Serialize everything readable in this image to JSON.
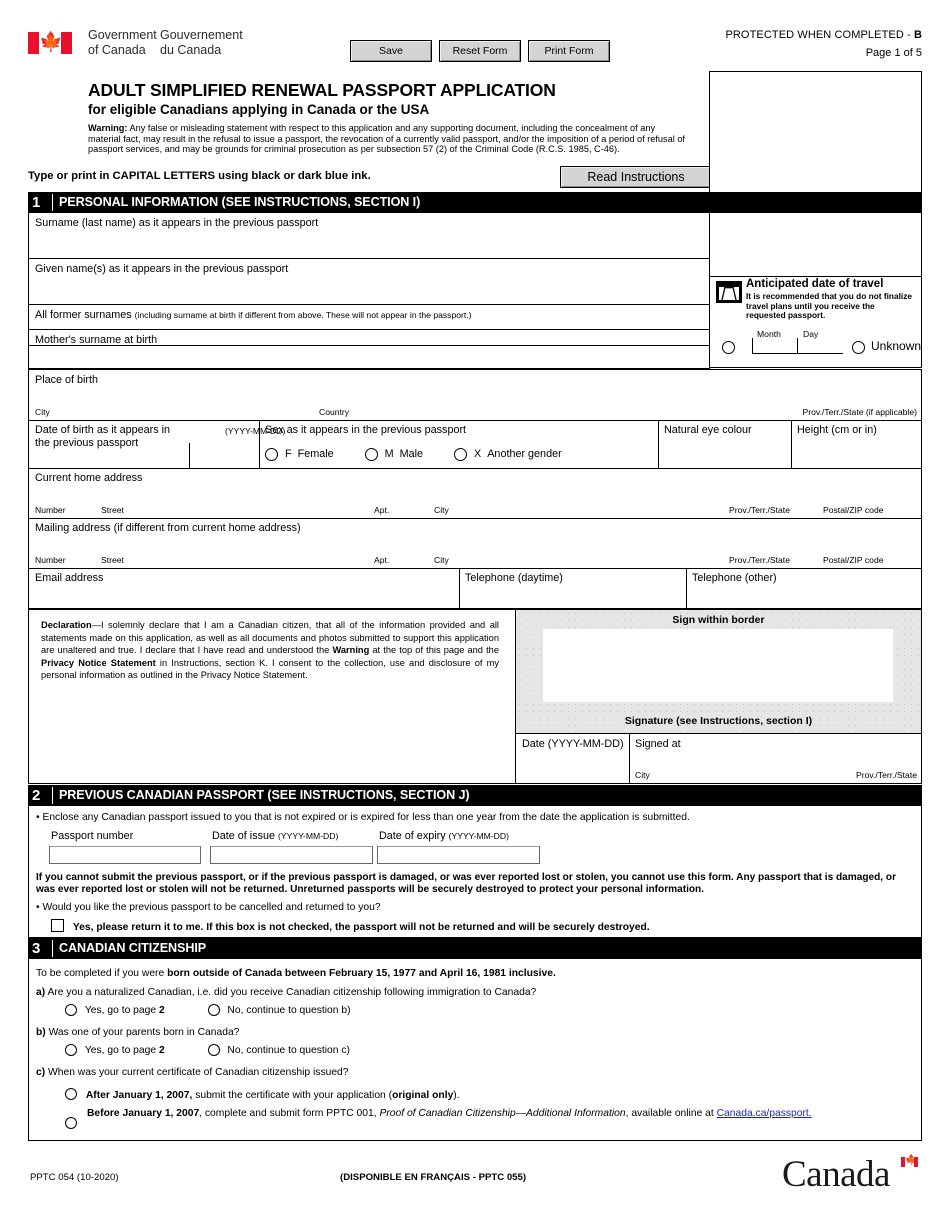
{
  "header": {
    "gov_en_line1": "Government",
    "gov_en_line2": "of Canada",
    "gov_fr_line1": "Gouvernement",
    "gov_fr_line2": "du Canada",
    "flag_icon": "canada-flag-icon",
    "buttons": {
      "save": "Save",
      "reset": "Reset Form",
      "print": "Print Form"
    },
    "protected_label": "PROTECTED WHEN COMPLETED - ",
    "protected_class": "B",
    "page_number": "Page 1 of 5"
  },
  "title": {
    "main": "ADULT SIMPLIFIED RENEWAL PASSPORT APPLICATION",
    "sub": "for eligible Canadians applying in Canada or the USA",
    "warning_label": "Warning:",
    "warning_text": " Any false or misleading statement with respect to this application and any supporting document, including the concealment of any material fact, may result in the refusal to issue a passport, the revocation of a currently valid passport, and/or the imposition of a period of refusal of passport services, and may be grounds for criminal prosecution as per subsection 57 (2) of the Criminal Code (R.C.S. 1985, C-46).",
    "type_print": "Type or print in CAPITAL LETTERS using black or dark blue ink.",
    "read_instructions": "Read Instructions"
  },
  "section1": {
    "number": "1",
    "heading": "PERSONAL INFORMATION (SEE INSTRUCTIONS, SECTION I)",
    "surname": "Surname (last name) as it appears in the previous passport",
    "given_names": "Given name(s) as it appears in the previous passport",
    "former_surnames_main": "All former surnames ",
    "former_surnames_note": "(including surname at birth if different from above. These will not appear in the passport.)",
    "mother_surname": "Mother's surname at birth",
    "place_of_birth": "Place of birth",
    "city": "City",
    "country": "Country",
    "prov_state_applicable": "Prov./Terr./State (if applicable)",
    "dob_label": "Date of birth as it appears in the previous passport",
    "dob_format": "(YYYY-MM-DD)",
    "sex_label": "Sex as it appears in the previous passport",
    "sex_options": [
      {
        "code": "F",
        "label": "Female"
      },
      {
        "code": "M",
        "label": "Male"
      },
      {
        "code": "X",
        "label": "Another gender"
      }
    ],
    "eye_colour": "Natural eye colour",
    "height": "Height (cm or in)",
    "home_address": "Current home address",
    "mailing_address": "Mailing address (if different from current home address)",
    "addr_number": "Number",
    "addr_street": "Street",
    "addr_apt": "Apt.",
    "addr_city": "City",
    "addr_prov": "Prov./Terr./State",
    "addr_postal": "Postal/ZIP code",
    "email": "Email address",
    "phone_day": "Telephone (daytime)",
    "phone_other": "Telephone (other)"
  },
  "photo_box": {
    "name": "photo-placeholder"
  },
  "travel": {
    "icon": "suitcase-icon",
    "title": "Anticipated date of travel",
    "subtitle": "It is recommended that you do not finalize travel plans until you receive the requested passport.",
    "month": "Month",
    "day": "Day",
    "unknown": "Unknown"
  },
  "declaration": {
    "label": "Declaration",
    "text_1": "—I solemnly declare that I am a Canadian citizen, that all of the information provided and all statements made on this application, as well as all documents and photos submitted to support this application are unaltered and true. I declare that I have read and understood the ",
    "bold_warning": "Warning",
    "text_2": " at the top of this page and the ",
    "bold_privacy": "Privacy Notice Statement",
    "text_3": " in Instructions, section K. I consent to the collection, use and disclosure of my personal information as outlined in the Privacy Notice Statement.",
    "sign_within_border": "Sign within border",
    "signature_caption": "Signature (see Instructions, section I)",
    "date_label": "Date (YYYY-MM-DD)",
    "signed_at": "Signed at",
    "signed_city": "City",
    "signed_prov": "Prov./Terr./State"
  },
  "section2": {
    "number": "2",
    "heading": "PREVIOUS CANADIAN PASSPORT (SEE INSTRUCTIONS, SECTION J)",
    "bullet1": "• Enclose any Canadian passport issued to you that is not expired or is expired for less than one year from the date the application is submitted.",
    "passport_number": "Passport number",
    "date_of_issue": "Date of issue ",
    "date_of_issue_fmt": "(YYYY-MM-DD)",
    "date_of_expiry": "Date of expiry ",
    "date_of_expiry_fmt": "(YYYY-MM-DD)",
    "warning_block": "If you cannot submit the previous passport, or if the previous passport is damaged, or was ever reported lost or stolen, you cannot use this form. Any passport that is damaged, or was ever reported lost or stolen will not be returned. Unreturned passports will be securely destroyed to protect your personal information.",
    "bullet2": "• Would you like the previous passport to be cancelled and returned to you?",
    "checkbox_label": "Yes, please return it to me. If this box is not checked, the passport will not be returned and will be securely destroyed."
  },
  "section3": {
    "number": "3",
    "heading": "CANADIAN CITIZENSHIP",
    "intro_plain": "To be completed if you were ",
    "intro_bold": "born outside of Canada between February 15, 1977 and April 16, 1981 inclusive.",
    "qa_marker": "a)",
    "qa_text": "Are you a naturalized Canadian, i.e. did you receive Canadian citizenship following immigration to Canada?",
    "qa_yes": "Yes, go to page ",
    "qa_yes_page": "2",
    "qa_no": "No, continue to question b)",
    "qb_marker": "b)",
    "qb_text": "Was one of your parents born in Canada?",
    "qb_yes": "Yes, go to page ",
    "qb_yes_page": "2",
    "qb_no": "No, continue to question c)",
    "qc_marker": "c)",
    "qc_text": "When was your current certificate of Canadian citizenship issued?",
    "opt1_bold": "After January 1, 2007,",
    "opt1_text": " submit the certificate with your application (",
    "opt1_bold2": "original only",
    "opt1_tail": ").",
    "opt2_bold": "Before January 1, 2007",
    "opt2_text": ", complete and submit form PPTC 001, ",
    "opt2_italic": "Proof of Canadian Citizenship—Additional Information",
    "opt2_text2": ", available online at ",
    "opt2_link": "Canada.ca/passport."
  },
  "footer": {
    "form_code": "PPTC 054 (10-2020)",
    "french_note": "(DISPONIBLE EN FRANÇAIS - PPTC 055)",
    "wordmark": "Canada",
    "wordmark_flag": "canada-wordmark-flag-icon"
  },
  "colors": {
    "flag_red": "#e8112d",
    "link_blue": "#1a1ae6",
    "section_bar": "#000000",
    "button_face": "#d4d4d4",
    "signature_bg": "#e6e6e6"
  }
}
